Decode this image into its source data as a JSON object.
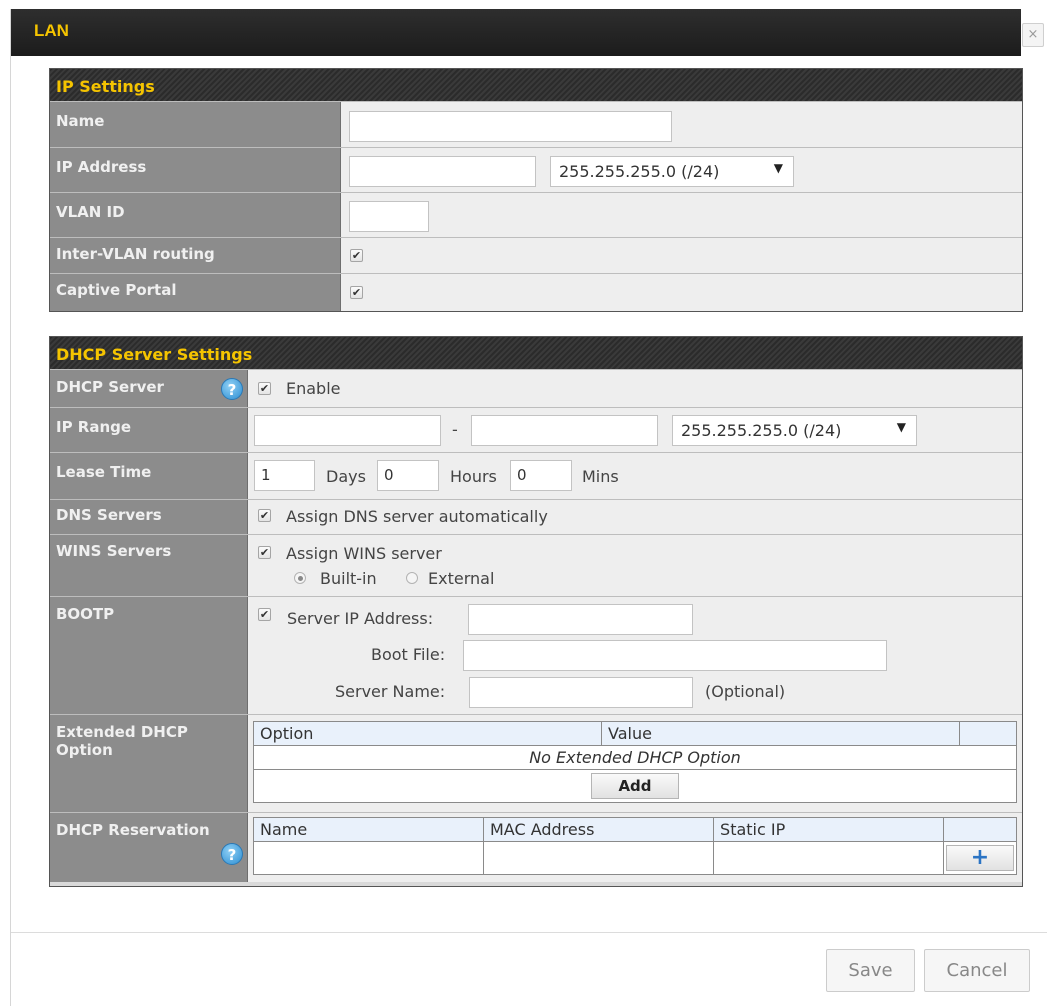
{
  "dialog": {
    "title": "LAN",
    "close_glyph": "×"
  },
  "ip_settings": {
    "header": "IP Settings",
    "name_label": "Name",
    "name_value": "",
    "ip_label": "IP Address",
    "ip_value": "",
    "subnet_value": "255.255.255.0 (/24)",
    "vlan_label": "VLAN ID",
    "vlan_value": "",
    "inter_vlan_label": "Inter-VLAN routing",
    "inter_vlan_checked": true,
    "captive_label": "Captive Portal",
    "captive_checked": true
  },
  "dhcp": {
    "header": "DHCP Server Settings",
    "server_label": "DHCP Server",
    "enable_label": "Enable",
    "range_label": "IP Range",
    "range_start": "",
    "range_sep": "-",
    "range_end": "",
    "range_subnet": "255.255.255.0 (/24)",
    "lease_label": "Lease Time",
    "lease_days": "1",
    "days_label": "Days",
    "lease_hours": "0",
    "hours_label": "Hours",
    "lease_mins": "0",
    "mins_label": "Mins",
    "dns_label": "DNS Servers",
    "dns_option": "Assign DNS server automatically",
    "wins_label": "WINS Servers",
    "wins_option": "Assign WINS server",
    "builtin_label": "Built-in",
    "external_label": "External",
    "wins_selected": "Built-in",
    "bootp_label": "BOOTP",
    "server_ip_label": "Server IP Address:",
    "server_ip_value": "",
    "boot_file_label": "Boot File:",
    "boot_file_value": "",
    "server_name_label": "Server Name:",
    "server_name_value": "",
    "optional_label": "(Optional)",
    "ext_label": "Extended DHCP Option",
    "ext_columns": [
      "Option",
      "Value"
    ],
    "ext_empty": "No Extended DHCP Option",
    "add_label": "Add",
    "res_label": "DHCP Reservation",
    "res_columns": [
      "Name",
      "MAC Address",
      "Static IP"
    ],
    "add_icon": "+"
  },
  "footer": {
    "save_label": "Save",
    "cancel_label": "Cancel"
  },
  "icons": {
    "help": "?",
    "check": "✔"
  }
}
